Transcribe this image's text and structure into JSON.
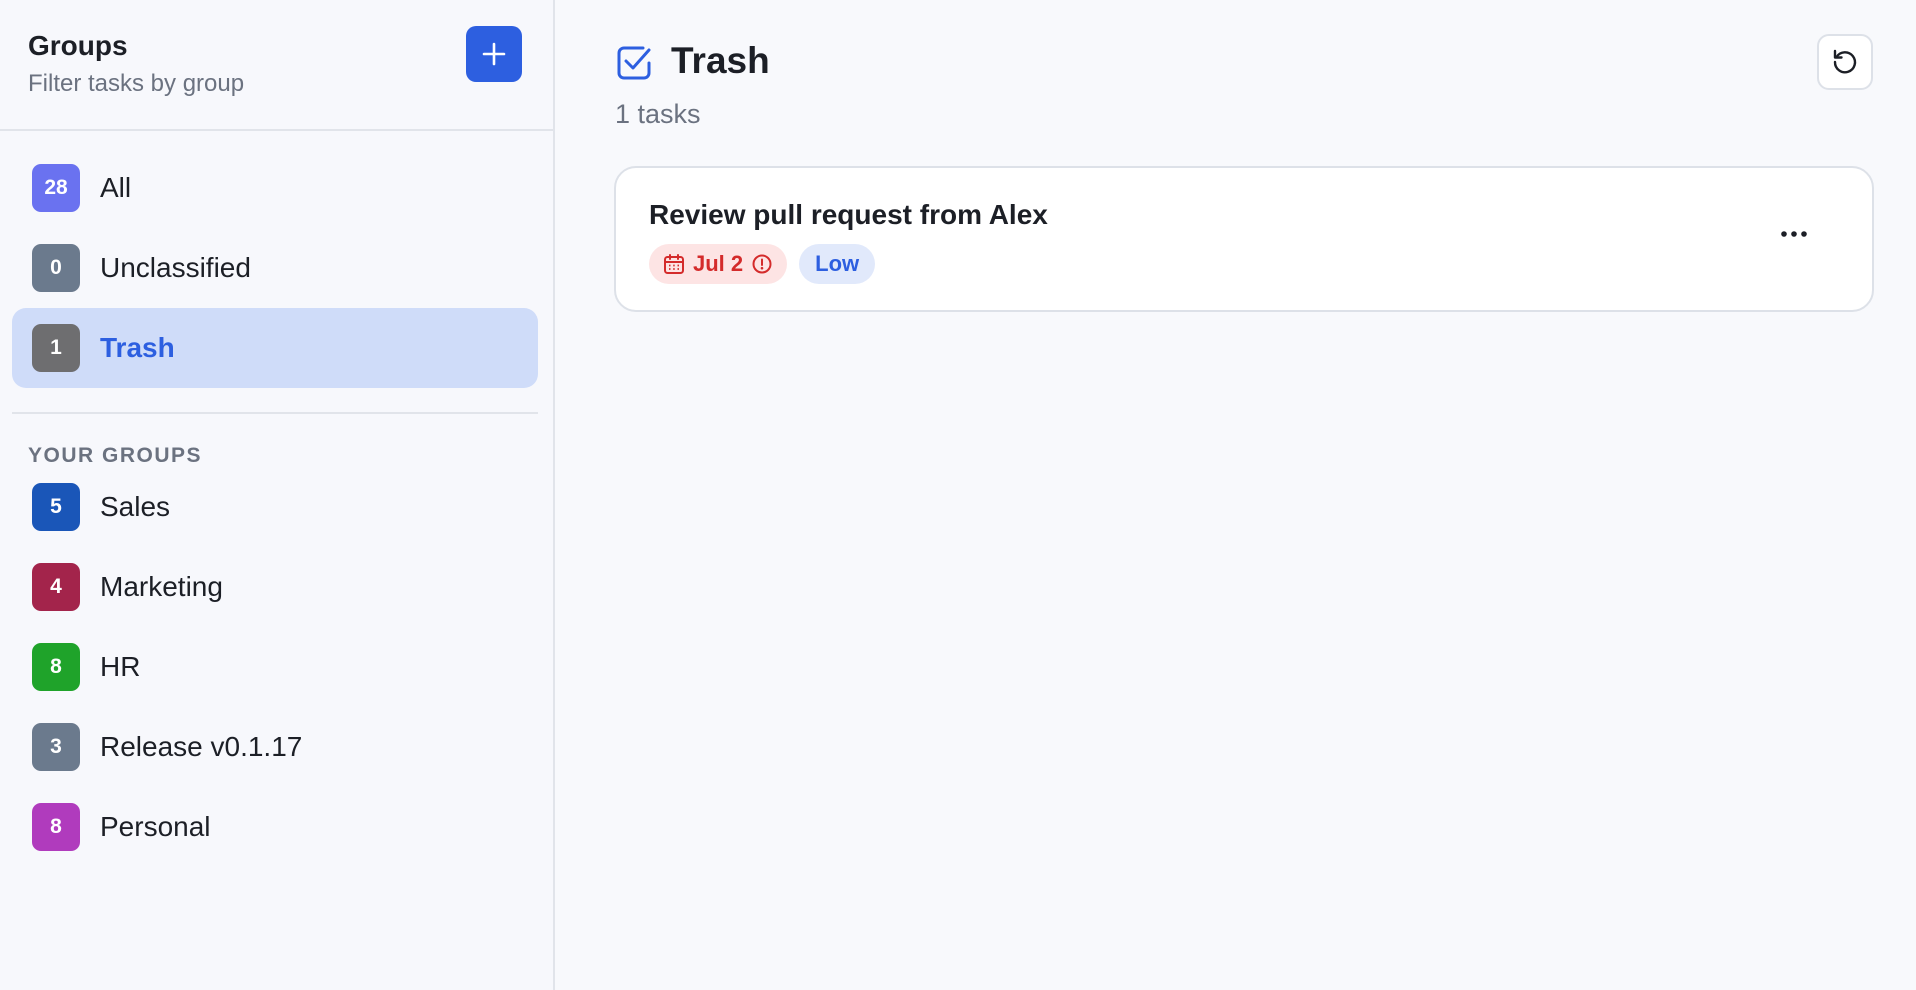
{
  "sidebar": {
    "title": "Groups",
    "subtitle": "Filter tasks by group",
    "add_button_icon": "plus-icon",
    "system_groups": [
      {
        "count": "28",
        "label": "All",
        "color": "#6a72f0",
        "active": false
      },
      {
        "count": "0",
        "label": "Unclassified",
        "color": "#6b7a8d",
        "active": false
      },
      {
        "count": "1",
        "label": "Trash",
        "color": "#6e6e70",
        "active": true
      }
    ],
    "section_label": "YOUR GROUPS",
    "user_groups": [
      {
        "count": "5",
        "label": "Sales",
        "color": "#1a56b8"
      },
      {
        "count": "4",
        "label": "Marketing",
        "color": "#a3244b"
      },
      {
        "count": "8",
        "label": "HR",
        "color": "#1fa32a"
      },
      {
        "count": "3",
        "label": "Release v0.1.17",
        "color": "#6b7a8d"
      },
      {
        "count": "8",
        "label": "Personal",
        "color": "#b03bbd"
      }
    ]
  },
  "main": {
    "title_icon": "checkbox-icon",
    "title": "Trash",
    "task_count": "1 tasks",
    "refresh_icon": "refresh-icon",
    "tasks": [
      {
        "title": "Review pull request from Alex",
        "due_date": "Jul 2",
        "priority": "Low",
        "overdue": true
      }
    ]
  },
  "colors": {
    "accent": "#2d5fe0",
    "overdue": "#d42b2b",
    "active_bg": "#cfdcf9"
  }
}
